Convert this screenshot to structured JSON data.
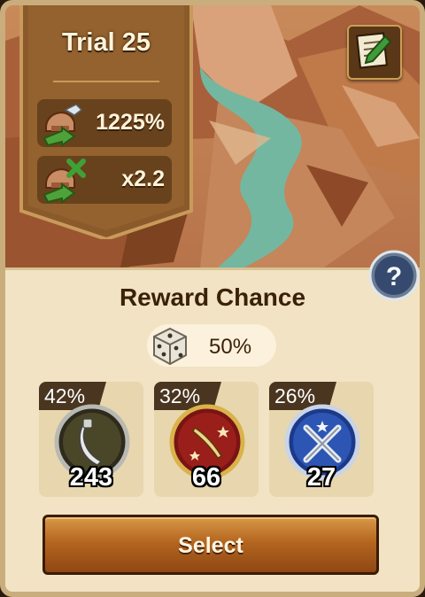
{
  "trial": {
    "title": "Trial 25",
    "stats": [
      {
        "icon": "attack-boost-icon",
        "value": "1225%"
      },
      {
        "icon": "defense-multiplier-icon",
        "value": "x2.2"
      }
    ]
  },
  "notes_icon": "notes-icon",
  "help_icon": "question-icon",
  "reward": {
    "title": "Reward Chance",
    "chance_icon": "dice-icon",
    "chance": "50%"
  },
  "slots": [
    {
      "percent": "42%",
      "count": "243",
      "medal": "silver-dagger-medal-icon"
    },
    {
      "percent": "32%",
      "count": "66",
      "medal": "red-dagger-medal-icon"
    },
    {
      "percent": "26%",
      "count": "27",
      "medal": "blue-crossed-swords-medal-icon"
    }
  ],
  "select_label": "Select",
  "colors": {
    "panel": "#f1e3c3",
    "banner": "#8b5a2b",
    "button": "#b4661f",
    "text_dark": "#3a2108"
  }
}
